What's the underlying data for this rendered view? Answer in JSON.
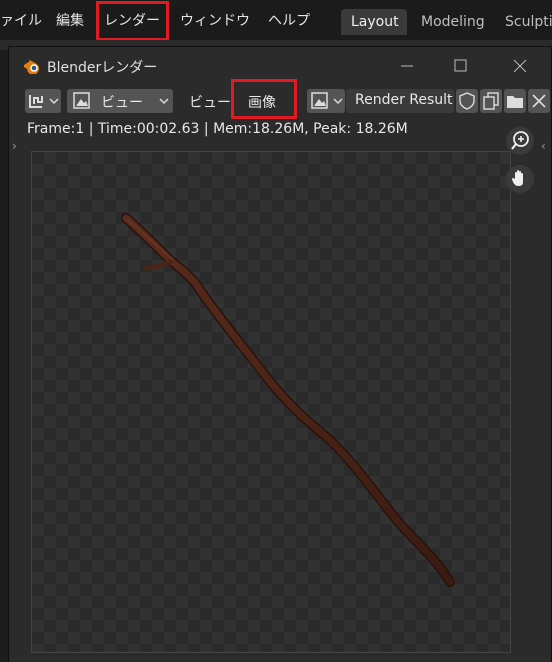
{
  "menubar": {
    "items": [
      "ァイル",
      "編集",
      "レンダー",
      "ウィンドウ",
      "ヘルプ"
    ],
    "workspaces": [
      "Layout",
      "Modeling",
      "Sculptin"
    ]
  },
  "window": {
    "title": "Blenderレンダー",
    "toolbar": {
      "view_menu": "ビュー",
      "view_label": "ビュー",
      "image_menu": "画像",
      "render_result": "Render Result"
    },
    "info": "Frame:1 | Time:00:02.63 | Mem:18.26M, Peak: 18.26M"
  },
  "colors": {
    "highlight": "#e11b22",
    "stick": "#4a2418",
    "accent_orange": "#e87d0d"
  }
}
